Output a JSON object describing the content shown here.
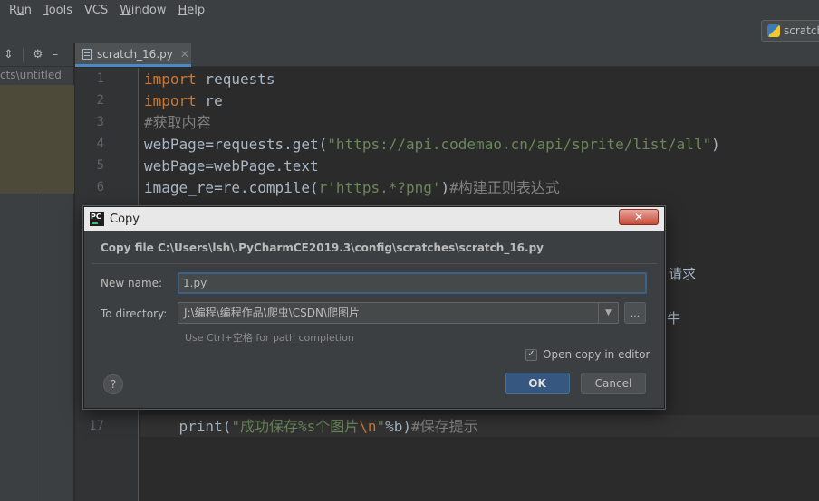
{
  "menubar": {
    "items": [
      {
        "label": "Run",
        "mnemonic_index": 1
      },
      {
        "label": "Tools",
        "mnemonic_index": 0
      },
      {
        "label": "VCS",
        "mnemonic_index": -1
      },
      {
        "label": "Window",
        "mnemonic_index": 0
      },
      {
        "label": "Help",
        "mnemonic_index": 0
      }
    ]
  },
  "toolbar": {
    "run_config_label": "scratch",
    "run_config_icon": "python-icon"
  },
  "project_panel": {
    "path_text": "cts\\untitled",
    "icons": [
      "collapse-all-icon",
      "gear-icon"
    ]
  },
  "editor": {
    "tab": {
      "label": "scratch_16.py",
      "icon": "python-file-icon"
    },
    "line_numbers": [
      "1",
      "2",
      "3",
      "4",
      "5",
      "6",
      "17"
    ],
    "lines": [
      {
        "segments": [
          {
            "t": "import",
            "c": "kw"
          },
          {
            "t": " requests",
            "c": ""
          }
        ]
      },
      {
        "segments": [
          {
            "t": "import",
            "c": "kw"
          },
          {
            "t": " re",
            "c": ""
          }
        ]
      },
      {
        "segments": [
          {
            "t": "#获取内容",
            "c": "cmt"
          }
        ]
      },
      {
        "segments": [
          {
            "t": "webPage=requests.get(",
            "c": ""
          },
          {
            "t": "\"https://api.codemao.cn/api/sprite/list/all\"",
            "c": "str"
          },
          {
            "t": ")",
            "c": ""
          }
        ]
      },
      {
        "segments": [
          {
            "t": "webPage=webPage.text",
            "c": ""
          }
        ]
      },
      {
        "segments": [
          {
            "t": "image_re=re.compile(",
            "c": ""
          },
          {
            "t": "r'https.*?png'",
            "c": "str"
          },
          {
            "t": ")",
            "c": ""
          },
          {
            "t": "#构建正则表达式",
            "c": "cmt"
          }
        ]
      },
      {
        "segments": [
          {
            "t": "    print(",
            "c": ""
          },
          {
            "t": "\"成功保存%s个图片",
            "c": "str"
          },
          {
            "t": "\\n",
            "c": "esc"
          },
          {
            "t": "\"",
            "c": "str"
          },
          {
            "t": "%b)",
            "c": ""
          },
          {
            "t": "#保存提示",
            "c": "cmt"
          }
        ]
      }
    ],
    "partial_fragments": [
      "请求",
      "牛"
    ]
  },
  "dialog": {
    "title": "Copy",
    "heading": "Copy file C:\\Users\\lsh\\.PyCharmCE2019.3\\config\\scratches\\scratch_16.py",
    "new_name_label": "New name:",
    "new_name_value": "1.py",
    "directory_label": "To directory:",
    "directory_value": "J:\\编程\\编程作品\\爬虫\\CSDN\\爬图片",
    "browse_label": "...",
    "hint": "Use Ctrl+空格 for path completion",
    "open_copy_label": "Open copy in editor",
    "open_copy_checked": true,
    "help_label": "?",
    "ok_label": "OK",
    "cancel_label": "Cancel",
    "close_glyph": "✕"
  },
  "colors": {
    "editor_bg": "#2b2b2b",
    "keyword": "#cc7832",
    "string": "#6a8759",
    "comment": "#808080",
    "accent": "#365880"
  }
}
